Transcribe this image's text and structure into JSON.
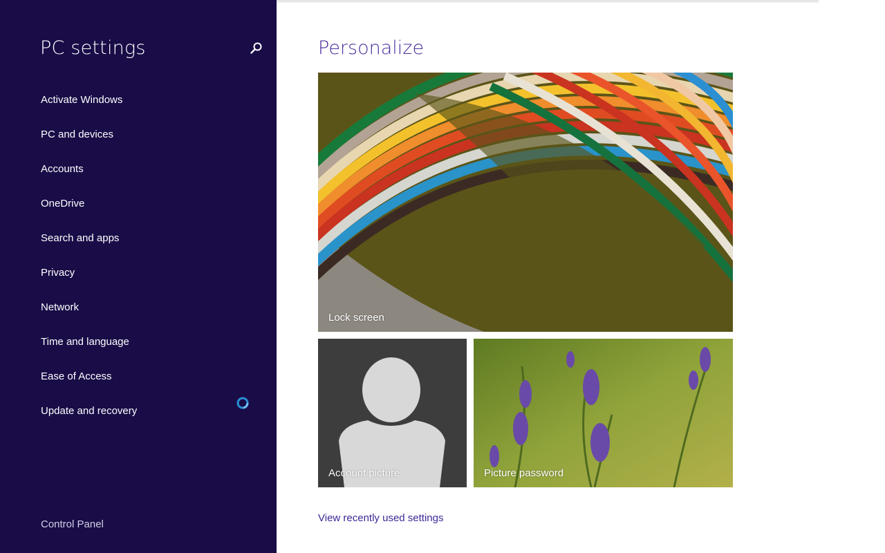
{
  "sidebar": {
    "title": "PC settings",
    "search_icon": "search-icon",
    "items": [
      {
        "label": "Activate Windows"
      },
      {
        "label": "PC and devices"
      },
      {
        "label": "Accounts"
      },
      {
        "label": "OneDrive"
      },
      {
        "label": "Search and apps"
      },
      {
        "label": "Privacy"
      },
      {
        "label": "Network"
      },
      {
        "label": "Time and language"
      },
      {
        "label": "Ease of Access"
      },
      {
        "label": "Update and recovery"
      }
    ],
    "footer_link": "Control Panel"
  },
  "main": {
    "title": "Personalize",
    "tiles": {
      "lock_screen": "Lock screen",
      "account_picture": "Account picture",
      "picture_password": "Picture password"
    },
    "recent_link": "View recently used settings"
  },
  "colors": {
    "sidebar_bg": "#190c47",
    "accent": "#4b2d9c",
    "spinner": "#2a8fd6"
  }
}
